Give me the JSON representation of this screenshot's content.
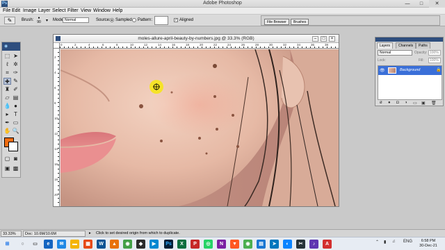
{
  "app": {
    "title": "Adobe Photoshop",
    "icon_label": "Ps"
  },
  "window_controls": {
    "minimize": "—",
    "maximize": "□",
    "close": "✕"
  },
  "menu": [
    "File",
    "Edit",
    "Image",
    "Layer",
    "Select",
    "Filter",
    "View",
    "Window",
    "Help"
  ],
  "options": {
    "brush_label": "Brush:",
    "brush_size": "90",
    "mode_label": "Mode:",
    "mode_value": "Normal",
    "source_label": "Source:",
    "sampled_label": "Sampled",
    "pattern_label": "Pattern:",
    "aligned_label": "Aligned",
    "aligned_checked": true,
    "file_browser": "File Browser",
    "brushes": "Brushes"
  },
  "document": {
    "title": "moles-allure-april-beauty-by-numbers.jpg @ 33.3% (RGB)",
    "ruler_h": [
      "0",
      "2",
      "4",
      "6",
      "8",
      "10",
      "12",
      "14",
      "16",
      "18",
      "20",
      "22",
      "24",
      "26",
      "28",
      "30",
      "32",
      "34",
      "36",
      "38"
    ],
    "ruler_v": [
      "2",
      "4",
      "6",
      "8",
      "10",
      "12",
      "14",
      "16",
      "18",
      "20"
    ]
  },
  "layers_panel": {
    "tabs": [
      "Layers",
      "Channels",
      "Paths"
    ],
    "blend_mode": "Normal",
    "opacity_label": "Opacity:",
    "opacity_value": "100%",
    "lock_label": "Lock:",
    "fill_label": "Fill:",
    "fill_value": "100%",
    "layer_name": "Background"
  },
  "status": {
    "zoom": "33.33%",
    "doc_info": "Doc: 10.6M/10.6M",
    "hint": "Click to set desired origin from which to duplicate."
  },
  "colors": {
    "foreground": "#f06c0f",
    "background": "#ffffff",
    "accent": "#2e4e7e",
    "selection": "#3a6fd8"
  },
  "taskbar": {
    "tray_lang": "ENG",
    "time": "6:58 PM",
    "date": "30-Dec-21"
  }
}
